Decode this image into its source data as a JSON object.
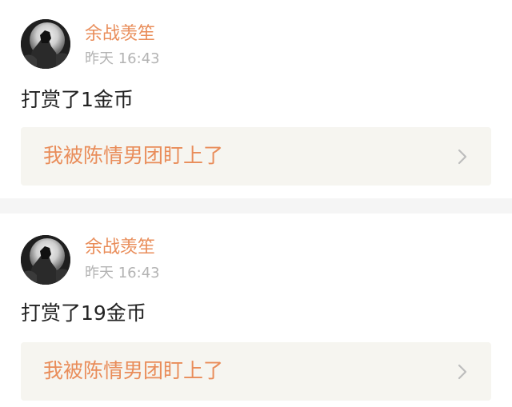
{
  "notifications": [
    {
      "username": "余战羡笙",
      "time": "昨天 16:43",
      "message": "打赏了1金币",
      "post_title": "我被陈情男团盯上了"
    },
    {
      "username": "余战羡笙",
      "time": "昨天 16:43",
      "message": "打赏了19金币",
      "post_title": "我被陈情男团盯上了"
    }
  ],
  "icons": {
    "avatar": "avatar-dark-figure-icon",
    "chevron": "chevron-right-icon"
  },
  "colors": {
    "accent": "#e98d5a",
    "timestamp": "#b3b3b3",
    "message_text": "#222222",
    "link_background": "#f6f5f0",
    "separator": "#f5f5f5"
  }
}
